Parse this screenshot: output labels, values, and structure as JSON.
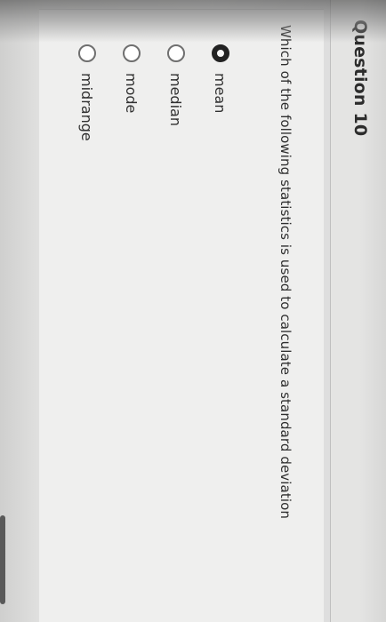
{
  "question": {
    "title": "Question 10",
    "prompt": "Which of the following statistics is used to calculate a standard deviation"
  },
  "options": [
    {
      "label": "mean",
      "selected": true
    },
    {
      "label": "median",
      "selected": false
    },
    {
      "label": "mode",
      "selected": false
    },
    {
      "label": "midrange",
      "selected": false
    }
  ]
}
